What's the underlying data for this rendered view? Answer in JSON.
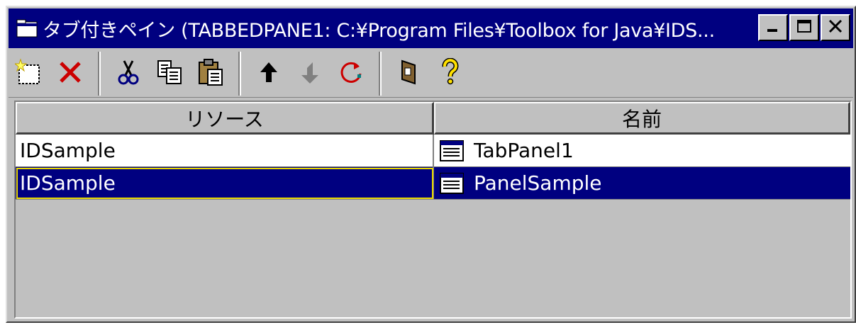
{
  "window": {
    "title": "タブ付きペイン (TABBEDPANE1: C:¥Program Files¥Toolbox for Java¥IDS...",
    "controls": {
      "minimize_icon": "minimize-icon",
      "maximize_icon": "maximize-icon",
      "close_icon": "close-icon"
    }
  },
  "toolbar": {
    "groups": [
      [
        {
          "icon": "new-icon"
        },
        {
          "icon": "delete-icon"
        }
      ],
      [
        {
          "icon": "cut-icon"
        },
        {
          "icon": "copy-icon"
        },
        {
          "icon": "paste-icon"
        }
      ],
      [
        {
          "icon": "move-up-icon"
        },
        {
          "icon": "move-down-icon"
        },
        {
          "icon": "refresh-icon"
        }
      ],
      [
        {
          "icon": "properties-icon"
        },
        {
          "icon": "help-icon"
        }
      ]
    ]
  },
  "table": {
    "headers": [
      "リソース",
      "名前"
    ],
    "rows": [
      {
        "resource": "IDSample",
        "name": "TabPanel1",
        "icon": "panel-icon",
        "selected": false
      },
      {
        "resource": "IDSample",
        "name": "PanelSample",
        "icon": "panel-icon",
        "selected": true
      }
    ]
  },
  "colors": {
    "titlebar": "#000080",
    "selection": "#000080",
    "face": "#c0c0c0",
    "focus_outline": "#e8d800",
    "delete_red": "#cc0000",
    "help_yellow": "#ffe000"
  }
}
